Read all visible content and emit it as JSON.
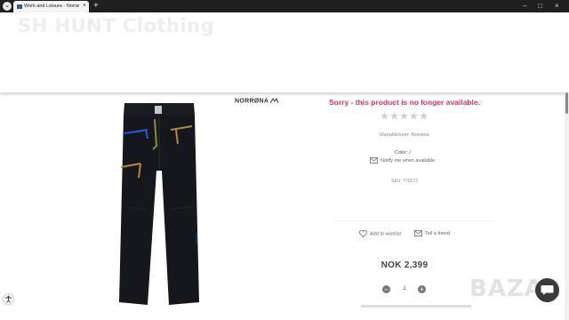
{
  "browser": {
    "tab_title": "Work and Leisure - Norrøna Sy...",
    "tab_close": "×",
    "new_tab": "+",
    "minimize": "–",
    "maximize": "□",
    "close": "×"
  },
  "site": {
    "title": "SH HUNT Clothing"
  },
  "product": {
    "brand": "NORRØNA",
    "unavailable_message": "Sorry - this product is no longer available.",
    "rating": {
      "filled": 0,
      "total": 5
    },
    "manufacturer": "Manufacturer: Norrøna",
    "color_label": "Color: /",
    "notify_label": "Notify me when available",
    "sku": "SKU: 770172",
    "wishlist_label": "Add to wishlist",
    "friend_label": "Tell a friend",
    "price": "NOK 2,399",
    "quantity": "1",
    "minus": "–",
    "plus": "+"
  },
  "watermark": "BAZAR",
  "colors": {
    "unavailable_text": "#e8325f",
    "star": "#cfcfcf",
    "header_title": "#eeeeee"
  },
  "icons": {
    "pants": "product-pants-image",
    "star": "star-icon",
    "mail": "envelope-icon",
    "heart": "heart-icon",
    "chat": "chat-icon"
  }
}
